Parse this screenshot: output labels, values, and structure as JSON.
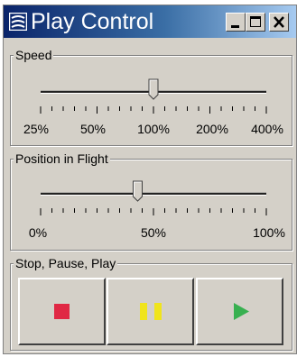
{
  "window": {
    "title": "Play Control",
    "app_icon": "app-icon",
    "controls": {
      "minimize_icon": "minimize-icon",
      "maximize_icon": "maximize-icon",
      "close_icon": "close-icon"
    }
  },
  "speed": {
    "legend": "Speed",
    "value_label": "100%",
    "value_fraction": 0.5,
    "tick_labels": [
      "25%",
      "50%",
      "100%",
      "200%",
      "400%"
    ]
  },
  "position": {
    "legend": "Position in Flight",
    "value_fraction": 0.43,
    "tick_labels": [
      "0%",
      "50%",
      "100%"
    ]
  },
  "playback": {
    "legend": "Stop, Pause, Play",
    "buttons": [
      {
        "icon": "stop-icon",
        "color": "#e02844"
      },
      {
        "icon": "pause-icon",
        "color": "#f0e41c"
      },
      {
        "icon": "play-icon",
        "color": "#38b050"
      }
    ]
  }
}
